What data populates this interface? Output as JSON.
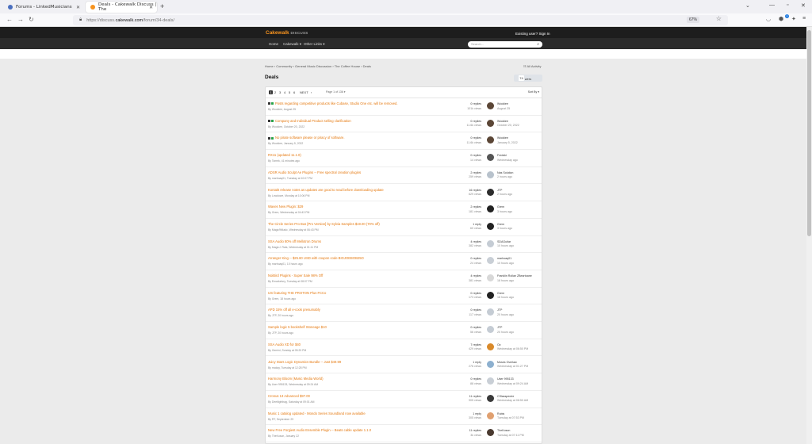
{
  "browser": {
    "tabs": [
      {
        "title": "Forums - LinkedMusicians",
        "active": false,
        "fav_color": "#4a6fbf"
      },
      {
        "title": "Deals - Cakewalk Discuss | The",
        "active": true,
        "fav_color": "#f7931e"
      }
    ],
    "url_prefix": "https://discuss.",
    "url_domain": "cakewalk.com",
    "url_path": "/forum/34-deals/",
    "zoom": "67%"
  },
  "site": {
    "logo_main": "Cakewalk",
    "logo_sub": "DISCUSS",
    "signin": "Existing user? Sign In",
    "nav": [
      "Home",
      "Cakewalk ▾",
      "Other Links ▾"
    ],
    "search_placeholder": "Search..."
  },
  "breadcrumb": "Home  ›  Community  ›  General Music Discussion  ›  The Coffee House  ›  Deals",
  "activity": "☷  All Activity",
  "page_title": "Deals",
  "follow": {
    "label": "Followers",
    "count": "74"
  },
  "pagination": {
    "pages": [
      "1",
      "2",
      "3",
      "4",
      "5",
      "6",
      "NEXT",
      "›"
    ],
    "page_of": "Page 1 of 136  ▾",
    "sort": "Sort By ▾"
  },
  "topics": [
    {
      "title": "Posts regarding competitive products like Cubase, Studio One etc. will be removed.",
      "meta": "By Wookiee, August 25",
      "replies": "0 replies",
      "views": "101k views",
      "last_user": "Wookiee",
      "last_time": "August 25",
      "pinned": true,
      "avatar": "#5b4636"
    },
    {
      "title": "Company and Individual Product selling clarification",
      "meta": "By Wookiee, October 20, 2022",
      "replies": "0 replies",
      "views": "11.6k views",
      "last_user": "Wookiee",
      "last_time": "October 20, 2022",
      "pinned": true,
      "avatar": "#5b4636"
    },
    {
      "title": "No pirate software please or piracy of software.",
      "meta": "By Wookiee, January 5, 2022",
      "replies": "0 replies",
      "views": "11.6k views",
      "last_user": "Wookiee",
      "last_time": "January 5, 2022",
      "pinned": true,
      "avatar": "#5b4636"
    },
    {
      "title": "RX11 (updated 11.1.0)",
      "meta": "By Tomek, 41 minutes ago",
      "replies": "0 replies",
      "views": "14 views",
      "last_user": "Fredski",
      "last_time": "Wednesday ago",
      "pinned": false,
      "avatar": "#555555"
    },
    {
      "title": "ADSR Audio Sculpt Ae Plugins -- Free spectral creation plugins",
      "meta": "By marhoaq01, Tuesday at 10:07 PM",
      "replies": "2 replies",
      "views": "259 views",
      "last_user": "Nas Solution",
      "last_time": "2 hours ago",
      "pinned": false,
      "avatar": "#b8c2cc"
    },
    {
      "title": "Kontakt release notes as updates are good to read before downloading update",
      "meta": "By Lowdowe, Monday at 10:06 PM",
      "replies": "16 replies",
      "views": "629 views",
      "last_user": "JTP",
      "last_time": "2 hours ago",
      "pinned": false,
      "avatar": "#2d2d2d"
    },
    {
      "title": "Waves New Plugin: $29",
      "meta": "By Grem, Wednesday at 04:43 PM",
      "replies": "2 replies",
      "views": "181 views",
      "last_user": "Grem",
      "last_time": "3 hours ago",
      "pinned": false,
      "avatar": "#222222"
    },
    {
      "title": "The Circle Series Pro Bus [Pro Version] by Sylvia Samples $19.00 (70% off)",
      "meta": "By Magic9Music, Wednesday at 06:43 PM",
      "replies": "1 reply",
      "views": "60 views",
      "last_user": "Grem",
      "last_time": "3 hours ago",
      "pinned": false,
      "avatar": "#222222"
    },
    {
      "title": "SSA Audio 80% off Mellotron Drums",
      "meta": "By MagicJ. Rats, Wednesday at 01:11 PM",
      "replies": "4 replies",
      "views": "382 views",
      "last_user": "SDAGuitar",
      "last_time": "10 hours ago",
      "pinned": false,
      "avatar": "#c5ccd4"
    },
    {
      "title": "Arranger King -- $25.60 USD with coupon code BIGJOEBOB25O",
      "meta": "By marhoaq01, 10 hours ago",
      "replies": "0 replies",
      "views": "24 views",
      "last_user": "marhoaq01",
      "last_time": "10 hours ago",
      "pinned": false,
      "avatar": "#c9cfd6"
    },
    {
      "title": "NoiBird Plugins - Super Sale 98% Off",
      "meta": "By Emarketvry, Tuesday at 08:07 PM",
      "replies": "4 replies",
      "views": "381 views",
      "last_user": "Franklin Rollan ZBeartoane",
      "last_time": "18 hours ago",
      "pinned": false,
      "avatar": "#d8d8d8"
    },
    {
      "title": "IJS featuring THE PROTON Plus FCCo",
      "meta": "By Grem, 18 hours ago",
      "replies": "0 replies",
      "views": "173 views",
      "last_user": "Grem",
      "last_time": "18 hours ago",
      "pinned": false,
      "avatar": "#222222"
    },
    {
      "title": "APD 15% off all e-cook presumably",
      "meta": "By JTP, 20 hours ago",
      "replies": "0 replies",
      "views": "117 views",
      "last_user": "JTP",
      "last_time": "20 hours ago",
      "pinned": false,
      "avatar": "#c5ccd4"
    },
    {
      "title": "Sample logic 5 bookshelf Stoneage $10",
      "meta": "By JTP, 20 hours ago",
      "replies": "0 replies",
      "views": "56 views",
      "last_user": "JTP",
      "last_time": "20 hours ago",
      "pinned": false,
      "avatar": "#c5ccd4"
    },
    {
      "title": "SSA Audio XD for $40",
      "meta": "By Gemini, Sunday at 05:20 PM",
      "replies": "7 replies",
      "views": "429 views",
      "last_user": "Oz",
      "last_time": "Wednesday at 06:50 PM",
      "pinned": false,
      "avatar": "#d98a2b"
    },
    {
      "title": "Juicy Stars Logic Dynamics Bundle -- Just $49.99",
      "meta": "By mcday, Tuesday at 12:28 PM",
      "replies": "1 reply",
      "views": "276 views",
      "last_user": "Moses Overlaw",
      "last_time": "Wednesday at 01:27 PM",
      "pinned": false,
      "avatar": "#8db0cf"
    },
    {
      "title": "Harmony Bloom (Music Media World)",
      "meta": "By User 995133, Wednesday at 09:24 AM",
      "replies": "0 replies",
      "views": "88 views",
      "last_user": "User 995133",
      "last_time": "Wednesday at 09:24 AM",
      "pinned": false,
      "avatar": "#c9cfd6"
    },
    {
      "title": "Cronus 13 Advanced $97.00",
      "meta": "By Deetlighthag, Saturday at 09:01 AM",
      "replies": "11 replies",
      "views": "905 views",
      "last_user": "CSlasspectre",
      "last_time": "Wednesday at 08:50 AM",
      "pinned": false,
      "avatar": "#3a3a3a"
    },
    {
      "title": "Music 1 catalog updated - Mondo Series Soundland now available",
      "meta": "By RT, September 29",
      "replies": "1 reply",
      "views": "305 views",
      "last_user": "Rubis",
      "last_time": "Tuesday at 07:53 PM",
      "pinned": false,
      "avatar": "#e0a070"
    },
    {
      "title": "New Free Forgiest Audio Ensemble Plugin -- Beats cable update 1.1.0",
      "meta": "By TheKoson, January 22",
      "replies": "11 replies",
      "views": "3k views",
      "last_user": "TheKoson",
      "last_time": "Tuesday at 07:11 PM",
      "pinned": false,
      "avatar": "#4a3a30"
    }
  ]
}
